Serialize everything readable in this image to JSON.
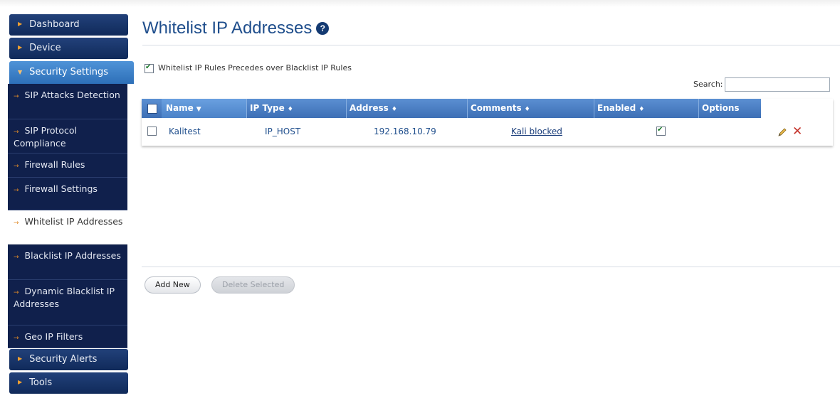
{
  "sidebar": {
    "top_items": [
      {
        "label": "Dashboard"
      },
      {
        "label": "Device"
      },
      {
        "label": "Security Settings"
      }
    ],
    "sub_items": [
      {
        "label": "SIP Attacks Detection"
      },
      {
        "label": "SIP Protocol Compliance"
      },
      {
        "label": "Firewall Rules"
      },
      {
        "label": "Firewall Settings"
      },
      {
        "label": "Whitelist IP Addresses"
      },
      {
        "label": "Blacklist IP Addresses"
      },
      {
        "label": "Dynamic Blacklist IP Addresses"
      },
      {
        "label": "Geo IP Filters"
      }
    ],
    "bottom_items": [
      {
        "label": "Security Alerts"
      },
      {
        "label": "Tools"
      }
    ],
    "active_sub": "Whitelist IP Addresses"
  },
  "page": {
    "title": "Whitelist IP Addresses",
    "help_glyph": "?",
    "precedence_label": "Whitelist IP Rules Precedes over Blacklist IP Rules",
    "precedence_checked": true,
    "search_label": "Search:",
    "search_value": ""
  },
  "table": {
    "columns": [
      {
        "label": "Name",
        "sort": "▼"
      },
      {
        "label": "IP Type",
        "sort": "♦"
      },
      {
        "label": "Address",
        "sort": "♦"
      },
      {
        "label": "Comments",
        "sort": "♦"
      },
      {
        "label": "Enabled",
        "sort": "♦"
      },
      {
        "label": "Options",
        "sort": ""
      }
    ],
    "rows": [
      {
        "name": "Kalitest",
        "ip_type": "IP_HOST",
        "address": "192.168.10.79",
        "comments": "Kali blocked",
        "enabled": true
      }
    ]
  },
  "buttons": {
    "add_new": "Add New",
    "delete_selected": "Delete Selected"
  },
  "colors": {
    "nav_dark": "#10204c",
    "nav_active": "#3a7dc6",
    "header_blue": "#4a7ec2",
    "title_blue": "#1f4e8c",
    "delete_red": "#c4322a"
  }
}
